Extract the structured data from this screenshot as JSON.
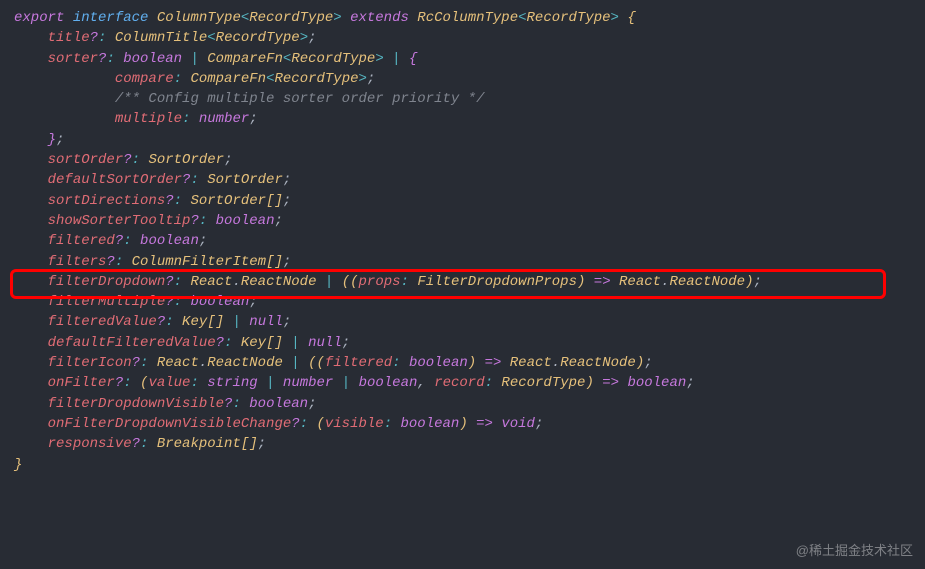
{
  "watermark": "@稀土掘金技术社区",
  "code": {
    "lines": [
      {
        "indent": 0,
        "segments": [
          {
            "t": "export ",
            "c": "k-export"
          },
          {
            "t": "interface ",
            "c": "k-interface"
          },
          {
            "t": "ColumnType",
            "c": "type-name"
          },
          {
            "t": "<",
            "c": "angle"
          },
          {
            "t": "RecordType",
            "c": "type-name"
          },
          {
            "t": "> ",
            "c": "angle"
          },
          {
            "t": "extends ",
            "c": "k-export"
          },
          {
            "t": "RcColumnType",
            "c": "type-name"
          },
          {
            "t": "<",
            "c": "angle"
          },
          {
            "t": "RecordType",
            "c": "type-name"
          },
          {
            "t": "> ",
            "c": "angle"
          },
          {
            "t": "{",
            "c": "brace"
          }
        ]
      },
      {
        "indent": 1,
        "segments": [
          {
            "t": "title",
            "c": "prop"
          },
          {
            "t": "?",
            "c": "ques"
          },
          {
            "t": ": ",
            "c": "colon"
          },
          {
            "t": "ColumnTitle",
            "c": "type-name"
          },
          {
            "t": "<",
            "c": "angle"
          },
          {
            "t": "RecordType",
            "c": "type-name"
          },
          {
            "t": ">",
            "c": "angle"
          },
          {
            "t": ";",
            "c": "punct"
          }
        ]
      },
      {
        "indent": 1,
        "segments": [
          {
            "t": "sorter",
            "c": "prop"
          },
          {
            "t": "?",
            "c": "ques"
          },
          {
            "t": ": ",
            "c": "colon"
          },
          {
            "t": "boolean",
            "c": "basic-type"
          },
          {
            "t": " | ",
            "c": "pipe"
          },
          {
            "t": "CompareFn",
            "c": "type-name"
          },
          {
            "t": "<",
            "c": "angle"
          },
          {
            "t": "RecordType",
            "c": "type-name"
          },
          {
            "t": ">",
            "c": "angle"
          },
          {
            "t": " | ",
            "c": "pipe"
          },
          {
            "t": "{",
            "c": "brace-p"
          }
        ]
      },
      {
        "indent": 3,
        "segments": [
          {
            "t": "compare",
            "c": "prop"
          },
          {
            "t": ": ",
            "c": "colon"
          },
          {
            "t": "CompareFn",
            "c": "type-name"
          },
          {
            "t": "<",
            "c": "angle"
          },
          {
            "t": "RecordType",
            "c": "type-name"
          },
          {
            "t": ">",
            "c": "angle"
          },
          {
            "t": ";",
            "c": "punct"
          }
        ]
      },
      {
        "indent": 3,
        "segments": [
          {
            "t": "/** Config multiple sorter order priority */",
            "c": "comment"
          }
        ]
      },
      {
        "indent": 3,
        "segments": [
          {
            "t": "multiple",
            "c": "prop"
          },
          {
            "t": ": ",
            "c": "colon"
          },
          {
            "t": "number",
            "c": "basic-type"
          },
          {
            "t": ";",
            "c": "punct"
          }
        ]
      },
      {
        "indent": 1,
        "segments": [
          {
            "t": "}",
            "c": "brace-p"
          },
          {
            "t": ";",
            "c": "punct"
          }
        ]
      },
      {
        "indent": 1,
        "segments": [
          {
            "t": "sortOrder",
            "c": "prop"
          },
          {
            "t": "?",
            "c": "ques"
          },
          {
            "t": ": ",
            "c": "colon"
          },
          {
            "t": "SortOrder",
            "c": "type-name"
          },
          {
            "t": ";",
            "c": "punct"
          }
        ]
      },
      {
        "indent": 1,
        "segments": [
          {
            "t": "defaultSortOrder",
            "c": "prop"
          },
          {
            "t": "?",
            "c": "ques"
          },
          {
            "t": ": ",
            "c": "colon"
          },
          {
            "t": "SortOrder",
            "c": "type-name"
          },
          {
            "t": ";",
            "c": "punct"
          }
        ]
      },
      {
        "indent": 1,
        "segments": [
          {
            "t": "sortDirections",
            "c": "prop"
          },
          {
            "t": "?",
            "c": "ques"
          },
          {
            "t": ": ",
            "c": "colon"
          },
          {
            "t": "SortOrder",
            "c": "type-name"
          },
          {
            "t": "[]",
            "c": "bracket"
          },
          {
            "t": ";",
            "c": "punct"
          }
        ]
      },
      {
        "indent": 1,
        "segments": [
          {
            "t": "showSorterTooltip",
            "c": "prop"
          },
          {
            "t": "?",
            "c": "ques"
          },
          {
            "t": ": ",
            "c": "colon"
          },
          {
            "t": "boolean",
            "c": "basic-type"
          },
          {
            "t": ";",
            "c": "punct"
          }
        ]
      },
      {
        "indent": 1,
        "segments": [
          {
            "t": "filtered",
            "c": "prop"
          },
          {
            "t": "?",
            "c": "ques"
          },
          {
            "t": ": ",
            "c": "colon"
          },
          {
            "t": "boolean",
            "c": "basic-type"
          },
          {
            "t": ";",
            "c": "punct"
          }
        ]
      },
      {
        "indent": 1,
        "segments": [
          {
            "t": "filters",
            "c": "prop"
          },
          {
            "t": "?",
            "c": "ques"
          },
          {
            "t": ": ",
            "c": "colon"
          },
          {
            "t": "ColumnFilterItem",
            "c": "type-name"
          },
          {
            "t": "[]",
            "c": "bracket"
          },
          {
            "t": ";",
            "c": "punct"
          }
        ]
      },
      {
        "indent": 1,
        "hl": true,
        "segments": [
          {
            "t": "filterDropdown",
            "c": "prop"
          },
          {
            "t": "?",
            "c": "ques"
          },
          {
            "t": ": ",
            "c": "colon"
          },
          {
            "t": "React",
            "c": "type-name"
          },
          {
            "t": ".",
            "c": "punct"
          },
          {
            "t": "ReactNode",
            "c": "type-name"
          },
          {
            "t": " | ",
            "c": "pipe"
          },
          {
            "t": "((",
            "c": "paren"
          },
          {
            "t": "props",
            "c": "prop"
          },
          {
            "t": ": ",
            "c": "colon"
          },
          {
            "t": "FilterDropdownProps",
            "c": "type-name"
          },
          {
            "t": ")",
            "c": "paren"
          },
          {
            "t": " => ",
            "c": "arrow"
          },
          {
            "t": "React",
            "c": "type-name"
          },
          {
            "t": ".",
            "c": "punct"
          },
          {
            "t": "ReactNode",
            "c": "type-name"
          },
          {
            "t": ")",
            "c": "paren"
          },
          {
            "t": ";",
            "c": "punct"
          }
        ]
      },
      {
        "indent": 1,
        "segments": [
          {
            "t": "filterMultiple",
            "c": "prop"
          },
          {
            "t": "?",
            "c": "ques"
          },
          {
            "t": ": ",
            "c": "colon"
          },
          {
            "t": "boolean",
            "c": "basic-type"
          },
          {
            "t": ";",
            "c": "punct"
          }
        ]
      },
      {
        "indent": 1,
        "segments": [
          {
            "t": "filteredValue",
            "c": "prop"
          },
          {
            "t": "?",
            "c": "ques"
          },
          {
            "t": ": ",
            "c": "colon"
          },
          {
            "t": "Key",
            "c": "type-name"
          },
          {
            "t": "[]",
            "c": "bracket"
          },
          {
            "t": " | ",
            "c": "pipe"
          },
          {
            "t": "null",
            "c": "basic-type"
          },
          {
            "t": ";",
            "c": "punct"
          }
        ]
      },
      {
        "indent": 1,
        "segments": [
          {
            "t": "defaultFilteredValue",
            "c": "prop"
          },
          {
            "t": "?",
            "c": "ques"
          },
          {
            "t": ": ",
            "c": "colon"
          },
          {
            "t": "Key",
            "c": "type-name"
          },
          {
            "t": "[]",
            "c": "bracket"
          },
          {
            "t": " | ",
            "c": "pipe"
          },
          {
            "t": "null",
            "c": "basic-type"
          },
          {
            "t": ";",
            "c": "punct"
          }
        ]
      },
      {
        "indent": 1,
        "segments": [
          {
            "t": "filterIcon",
            "c": "prop"
          },
          {
            "t": "?",
            "c": "ques"
          },
          {
            "t": ": ",
            "c": "colon"
          },
          {
            "t": "React",
            "c": "type-name"
          },
          {
            "t": ".",
            "c": "punct"
          },
          {
            "t": "ReactNode",
            "c": "type-name"
          },
          {
            "t": " | ",
            "c": "pipe"
          },
          {
            "t": "((",
            "c": "paren"
          },
          {
            "t": "filtered",
            "c": "prop"
          },
          {
            "t": ": ",
            "c": "colon"
          },
          {
            "t": "boolean",
            "c": "basic-type"
          },
          {
            "t": ")",
            "c": "paren"
          },
          {
            "t": " => ",
            "c": "arrow"
          },
          {
            "t": "React",
            "c": "type-name"
          },
          {
            "t": ".",
            "c": "punct"
          },
          {
            "t": "ReactNode",
            "c": "type-name"
          },
          {
            "t": ")",
            "c": "paren"
          },
          {
            "t": ";",
            "c": "punct"
          }
        ]
      },
      {
        "indent": 1,
        "segments": [
          {
            "t": "onFilter",
            "c": "prop"
          },
          {
            "t": "?",
            "c": "ques"
          },
          {
            "t": ": ",
            "c": "colon"
          },
          {
            "t": "(",
            "c": "paren"
          },
          {
            "t": "value",
            "c": "prop"
          },
          {
            "t": ": ",
            "c": "colon"
          },
          {
            "t": "string",
            "c": "basic-type"
          },
          {
            "t": " | ",
            "c": "pipe"
          },
          {
            "t": "number",
            "c": "basic-type"
          },
          {
            "t": " | ",
            "c": "pipe"
          },
          {
            "t": "boolean",
            "c": "basic-type"
          },
          {
            "t": ", ",
            "c": "punct"
          },
          {
            "t": "record",
            "c": "prop"
          },
          {
            "t": ": ",
            "c": "colon"
          },
          {
            "t": "RecordType",
            "c": "type-name"
          },
          {
            "t": ")",
            "c": "paren"
          },
          {
            "t": " => ",
            "c": "arrow"
          },
          {
            "t": "boolean",
            "c": "basic-type"
          },
          {
            "t": ";",
            "c": "punct"
          }
        ]
      },
      {
        "indent": 1,
        "segments": [
          {
            "t": "filterDropdownVisible",
            "c": "prop"
          },
          {
            "t": "?",
            "c": "ques"
          },
          {
            "t": ": ",
            "c": "colon"
          },
          {
            "t": "boolean",
            "c": "basic-type"
          },
          {
            "t": ";",
            "c": "punct"
          }
        ]
      },
      {
        "indent": 1,
        "segments": [
          {
            "t": "onFilterDropdownVisibleChange",
            "c": "prop"
          },
          {
            "t": "?",
            "c": "ques"
          },
          {
            "t": ": ",
            "c": "colon"
          },
          {
            "t": "(",
            "c": "paren"
          },
          {
            "t": "visible",
            "c": "prop"
          },
          {
            "t": ": ",
            "c": "colon"
          },
          {
            "t": "boolean",
            "c": "basic-type"
          },
          {
            "t": ")",
            "c": "paren"
          },
          {
            "t": " => ",
            "c": "arrow"
          },
          {
            "t": "void",
            "c": "basic-type"
          },
          {
            "t": ";",
            "c": "punct"
          }
        ]
      },
      {
        "indent": 1,
        "segments": [
          {
            "t": "responsive",
            "c": "prop"
          },
          {
            "t": "?",
            "c": "ques"
          },
          {
            "t": ": ",
            "c": "colon"
          },
          {
            "t": "Breakpoint",
            "c": "type-name"
          },
          {
            "t": "[]",
            "c": "bracket"
          },
          {
            "t": ";",
            "c": "punct"
          }
        ]
      },
      {
        "indent": 0,
        "segments": [
          {
            "t": "}",
            "c": "brace"
          }
        ]
      }
    ]
  }
}
